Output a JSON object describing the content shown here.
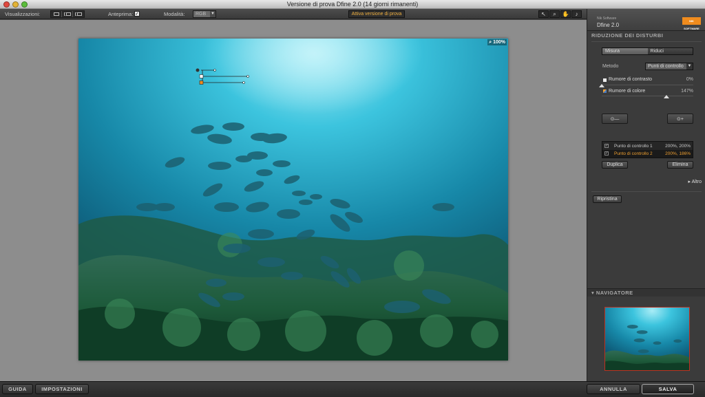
{
  "window": {
    "title": "Versione di prova Dfine 2.0 (14 giorni rimanenti)"
  },
  "toolbar": {
    "views_label": "Visualizzazioni:",
    "preview_label": "Anteprima:",
    "preview_checked": "✓",
    "mode_label": "Modalità:",
    "mode_value": "RGB",
    "trial_button": "Attiva versione di prova",
    "tool_icons": [
      "↖",
      "⌕",
      "✋",
      "♪"
    ]
  },
  "canvas": {
    "zoom": "100%"
  },
  "panel": {
    "brand_company": "Nik Software",
    "brand_product": "Dfine 2.0",
    "brand_logo": "NIK SOFTWARE",
    "section_title": "RIDUZIONE DEI DISTURBI",
    "tabs": [
      "Misura",
      "Riduci"
    ],
    "method_label": "Metodo",
    "method_value": "Punti di controllo",
    "contrast_noise_label": "Rumore di contrasto",
    "contrast_noise_value": "0%",
    "contrast_noise_fraction": 0.0,
    "color_noise_label": "Rumore di colore",
    "color_noise_value": "147%",
    "color_noise_fraction": 0.71,
    "control_points": [
      {
        "name": "Punto di controllo 1",
        "value": "200%, 200%"
      },
      {
        "name": "Punto di controllo 2",
        "value": "200%, 186%"
      }
    ],
    "duplicate_button": "Duplica",
    "delete_button": "Elimina",
    "more_link": "Altro",
    "reset_button": "Ripristina",
    "navigator_title": "NAVIGATORE"
  },
  "bottom": {
    "help_button": "GUIDA",
    "settings_button": "IMPOSTAZIONI",
    "cancel_button": "ANNULLA",
    "save_button": "SALVA"
  },
  "colors": {
    "accent_orange": "#f0a030",
    "selected_row_text": "#f0a030"
  }
}
